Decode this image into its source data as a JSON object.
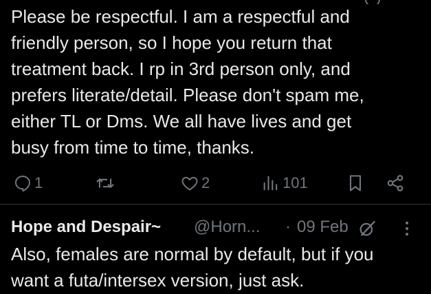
{
  "post": {
    "body": "Please be respectful. I am a respectful and\nfriendly person, so I hope you return that\ntreatment back. I rp in 3rd person only, and\nprefers literate/detail. Please don't spam me,\neither TL or Dms. We all have lives and get\nbusy from time to time, thanks.",
    "actions": {
      "reply_count": "1",
      "repost_count": "",
      "like_count": "2",
      "view_count": "101"
    }
  },
  "reply": {
    "author_name": "Hope and Despair~",
    "author_handle": "@Horn...",
    "separator": "·",
    "date": "09 Feb",
    "body": "Also, females are normal by default, but if you\nwant a futa/intersex version, just ask."
  },
  "icons": {
    "reply": "reply-icon",
    "repost": "repost-icon",
    "like": "heart-icon",
    "views": "views-icon",
    "bookmark": "bookmark-icon",
    "share": "share-icon",
    "grok": "grok-icon",
    "more": "more-icon"
  },
  "colors": {
    "background": "#000000",
    "text_primary": "#e7e9ea",
    "text_secondary": "#71767b",
    "divider": "#2f3336"
  }
}
